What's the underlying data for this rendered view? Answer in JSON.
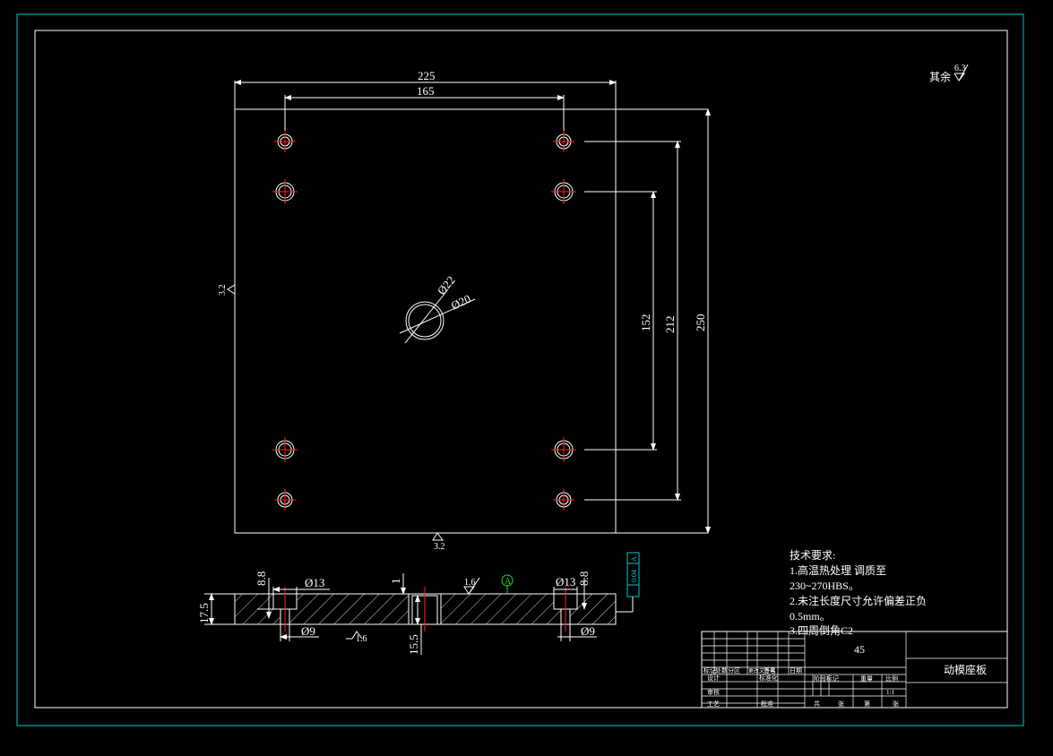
{
  "drawing": {
    "surface_note": {
      "prefix": "其余",
      "value": "6.3"
    },
    "top_view": {
      "dim_225": "225",
      "dim_165": "165",
      "dim_152": "152",
      "dim_212": "212",
      "dim_250": "250",
      "dim_phi22": "Ø22",
      "dim_phi20": "Ø20",
      "rough_left": "3.2",
      "rough_bottom": "3.2"
    },
    "section_view": {
      "dim_8_8_left": "8.8",
      "dim_phi13_left": "Ø13",
      "dim_1": "1",
      "rough_top": "1.6",
      "datum": "A",
      "dim_phi13_right": "Ø13",
      "dim_8_8_right": "8.8",
      "dim_17_5": "17.5",
      "dim_phi9_left": "Ø9",
      "rough_bottom": "1.6",
      "dim_15_5": "15.5",
      "dim_phi9_right": "Ø9",
      "tolerance_value": "0.04",
      "tolerance_datum": "A"
    },
    "tech_requirements": {
      "title": "技术要求:",
      "line1": "1.高温热处理 调质至",
      "line2": "230~270HBS。",
      "line3": "2.未注长度尺寸允许偏差正负",
      "line4": "0.5mm。",
      "line5": "3.四周倒角C2"
    },
    "title_block": {
      "material": "45",
      "part_name": "动模座板",
      "scale": "1:1",
      "hdr_mark": "标记",
      "hdr_count": "处数",
      "hdr_zone": "分区",
      "hdr_change_doc": "更改文件号",
      "hdr_sign": "签名",
      "hdr_date": "日期",
      "hdr_design": "设计",
      "hdr_standard": "标准化",
      "hdr_review": "审核",
      "hdr_process": "工艺",
      "hdr_approve": "批准",
      "hdr_stage": "阶段标记",
      "hdr_weight": "重量",
      "hdr_ratio": "比例",
      "hdr_total": "共",
      "hdr_sheet": "张",
      "hdr_no": "第"
    }
  },
  "colors": {
    "line": "#ffffff",
    "frame": "#00c8c8",
    "center": "#ff2020",
    "datum": "#20e020"
  }
}
